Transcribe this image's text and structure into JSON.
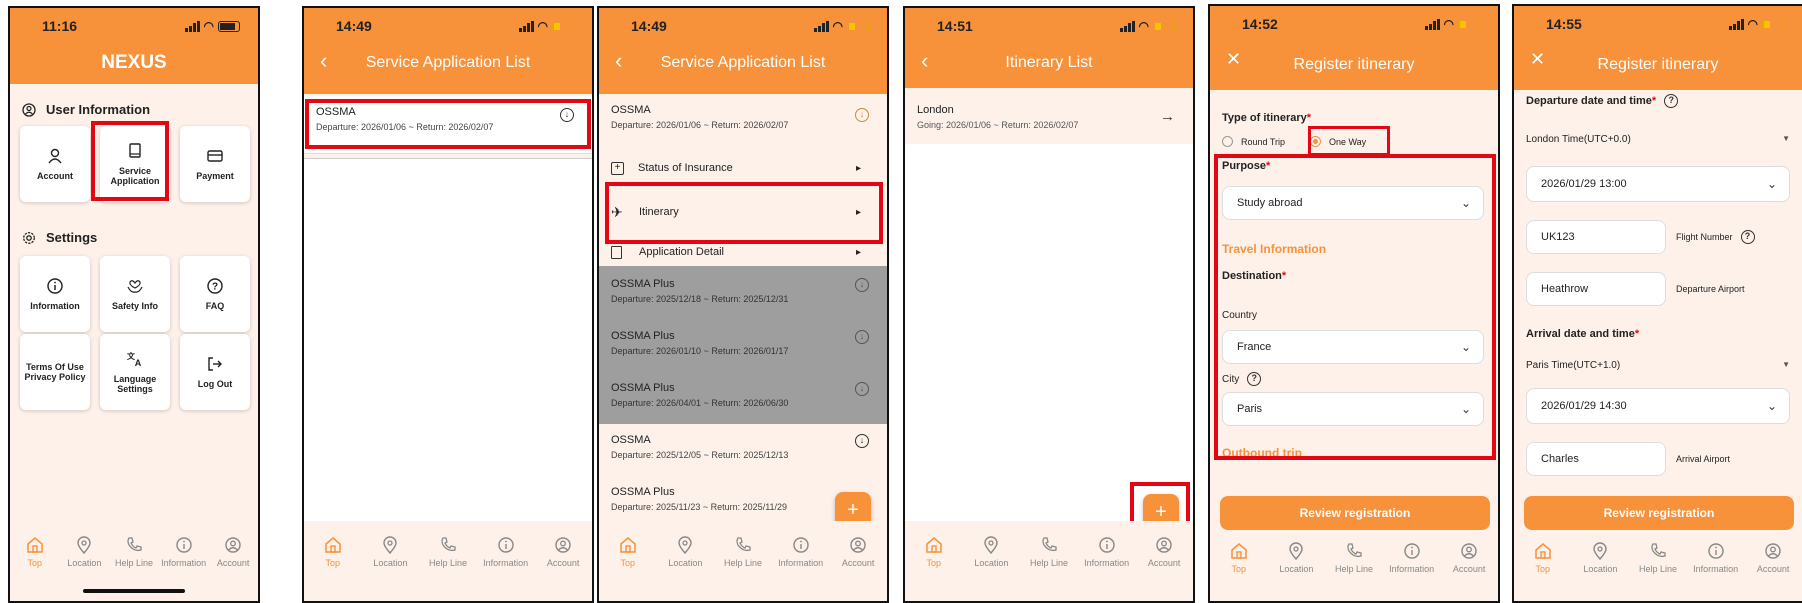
{
  "colors": {
    "brand": "#f7913a",
    "highlight": "#e30613",
    "bg": "#fdf1ea"
  },
  "nav_items": [
    "Top",
    "Location",
    "Help Line",
    "Information",
    "Account"
  ],
  "s1": {
    "time": "11:16",
    "app_title": "NEXUS",
    "user_info_header": "User Information",
    "cards": [
      "Account",
      "Service Application",
      "Payment"
    ],
    "settings_header": "Settings",
    "settings_cards": [
      "Information",
      "Safety Info",
      "FAQ",
      "Terms Of Use Privacy Policy",
      "Language Settings",
      "Log Out"
    ]
  },
  "s2": {
    "time": "14:49",
    "title": "Service Application List",
    "item_title": "OSSMA",
    "item_sub": "Departure: 2026/01/06 ~ Return: 2026/02/07"
  },
  "s3": {
    "time": "14:49",
    "title": "Service Application List",
    "top_title": "OSSMA",
    "top_sub": "Departure: 2026/01/06 ~ Return: 2026/02/07",
    "menu": [
      "Status of Insurance",
      "Itinerary",
      "Application Detail"
    ],
    "grey_items": [
      {
        "t": "OSSMA Plus",
        "s": "Departure: 2025/12/18 ~ Return: 2025/12/31"
      },
      {
        "t": "OSSMA Plus",
        "s": "Departure: 2026/01/10 ~ Return: 2026/01/17"
      },
      {
        "t": "OSSMA Plus",
        "s": "Departure: 2026/04/01 ~ Return: 2026/06/30"
      }
    ],
    "white_items": [
      {
        "t": "OSSMA",
        "s": "Departure: 2025/12/05 ~ Return: 2025/12/13"
      },
      {
        "t": "OSSMA Plus",
        "s": "Departure: 2025/11/23 ~ Return: 2025/11/29"
      }
    ]
  },
  "s4": {
    "time": "14:51",
    "title": "Itinerary List",
    "item_title": "London",
    "item_sub": "Going: 2026/01/06 ~ Return: 2026/02/07"
  },
  "s5": {
    "time": "14:52",
    "title": "Register itinerary",
    "type_label": "Type of itinerary",
    "round_trip": "Round Trip",
    "one_way": "One Way",
    "purpose_label": "Purpose",
    "purpose_value": "Study abroad",
    "travel_info": "Travel Information",
    "destination": "Destination",
    "country_label": "Country",
    "country_value": "France",
    "city_label": "City",
    "city_value": "Paris",
    "outbound": "Outbound trip",
    "review_btn": "Review registration"
  },
  "s6": {
    "time": "14:55",
    "title": "Register itinerary",
    "dep_label": "Departure date and time",
    "dep_tz": "London Time(UTC+0.0)",
    "dep_dt": "2026/01/29 13:00",
    "flight_value": "UK123",
    "flight_label": "Flight Number",
    "dep_airport_value": "Heathrow",
    "dep_airport_label": "Departure Airport",
    "arr_label": "Arrival date and time",
    "arr_tz": "Paris Time(UTC+1.0)",
    "arr_dt": "2026/01/29 14:30",
    "arr_airport_value": "Charles",
    "arr_airport_label": "Arrival Airport",
    "review_btn": "Review registration"
  }
}
